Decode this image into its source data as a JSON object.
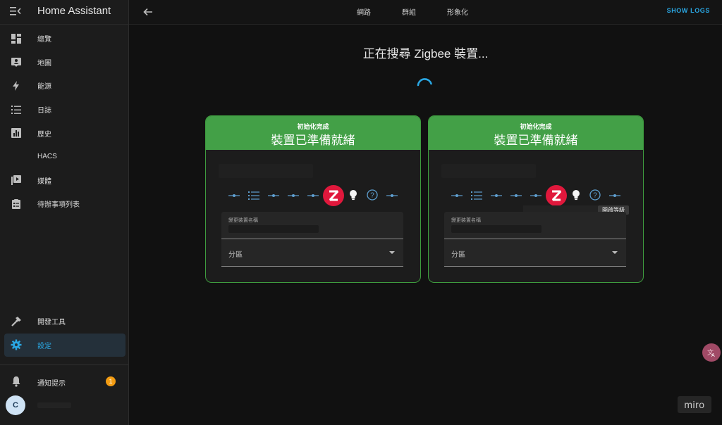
{
  "app": {
    "title": "Home Assistant"
  },
  "sidebar": {
    "items": [
      {
        "label": "總覽",
        "icon": "dashboard-icon"
      },
      {
        "label": "地圖",
        "icon": "map-icon"
      },
      {
        "label": "能源",
        "icon": "lightning-icon"
      },
      {
        "label": "日誌",
        "icon": "logbook-icon"
      },
      {
        "label": "歷史",
        "icon": "history-chart-icon"
      },
      {
        "label": "HACS",
        "icon": ""
      },
      {
        "label": "媒體",
        "icon": "media-icon"
      },
      {
        "label": "待辦事項列表",
        "icon": "todo-list-icon"
      }
    ],
    "dev_tools": "開發工具",
    "settings": "設定",
    "notifications": "通知提示",
    "notifications_count": "1",
    "user_initial": "C"
  },
  "topbar": {
    "tabs": [
      "網路",
      "群組",
      "形象化"
    ],
    "show_logs": "SHOW LOGS"
  },
  "main": {
    "searching_text": "正在搜尋 Zigbee 裝置...",
    "cards": [
      {
        "status": "初始化完成",
        "title": "裝置已準備就緒",
        "field_name_label": "變更裝置名稱",
        "area_label": "分區"
      },
      {
        "status": "初始化完成",
        "title": "裝置已準備就緒",
        "field_name_label": "變更裝置名稱",
        "area_label": "分區",
        "tooltip": "開啟等級"
      }
    ]
  },
  "watermark": "miro",
  "colors": {
    "accent": "#2aa7e3",
    "success": "#43a047",
    "zigbee": "#e0183c",
    "badge": "#f39c12"
  }
}
